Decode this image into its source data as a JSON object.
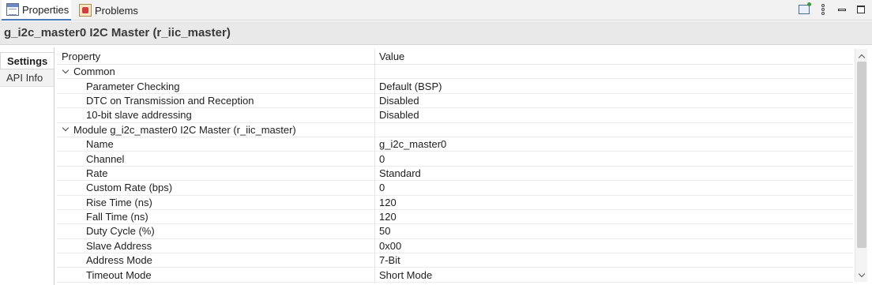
{
  "tabs": [
    {
      "label": "Properties",
      "icon": "properties-icon",
      "active": true
    },
    {
      "label": "Problems",
      "icon": "problems-icon",
      "active": false
    }
  ],
  "toolbar": {
    "icons": [
      "pin-view-icon",
      "view-menu-icon",
      "minimize-icon",
      "maximize-icon"
    ]
  },
  "header": {
    "title": "g_i2c_master0 I2C Master (r_iic_master)"
  },
  "sidetabs": [
    {
      "label": "Settings",
      "active": true
    },
    {
      "label": "API Info",
      "active": false
    }
  ],
  "grid": {
    "columns": {
      "property": "Property",
      "value": "Value"
    },
    "rows": [
      {
        "type": "group",
        "property": "Common",
        "value": ""
      },
      {
        "type": "child",
        "property": "Parameter Checking",
        "value": "Default (BSP)"
      },
      {
        "type": "child",
        "property": "DTC on Transmission and Reception",
        "value": "Disabled"
      },
      {
        "type": "child",
        "property": "10-bit slave addressing",
        "value": "Disabled"
      },
      {
        "type": "group",
        "property": "Module g_i2c_master0 I2C Master (r_iic_master)",
        "value": ""
      },
      {
        "type": "child",
        "property": "Name",
        "value": "g_i2c_master0"
      },
      {
        "type": "child",
        "property": "Channel",
        "value": "0"
      },
      {
        "type": "child",
        "property": "Rate",
        "value": "Standard"
      },
      {
        "type": "child",
        "property": "Custom Rate (bps)",
        "value": "0"
      },
      {
        "type": "child",
        "property": "Rise Time (ns)",
        "value": "120"
      },
      {
        "type": "child",
        "property": "Fall Time (ns)",
        "value": "120"
      },
      {
        "type": "child",
        "property": "Duty Cycle (%)",
        "value": "50"
      },
      {
        "type": "child",
        "property": "Slave Address",
        "value": "0x00"
      },
      {
        "type": "child",
        "property": "Address Mode",
        "value": "7-Bit"
      },
      {
        "type": "child",
        "property": "Timeout Mode",
        "value": "Short Mode"
      }
    ]
  }
}
